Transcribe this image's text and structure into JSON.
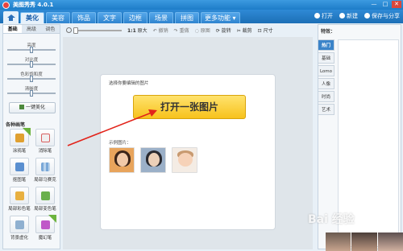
{
  "app": {
    "title": "美图秀秀 4.0.1"
  },
  "window": {
    "minimize": "—",
    "maximize": "□",
    "close": "✕"
  },
  "nav": {
    "tabs": [
      "美化",
      "美容",
      "饰品",
      "文字",
      "边框",
      "场景",
      "拼图"
    ],
    "more": "更多功能",
    "active_index": 0,
    "right": {
      "open": "打开",
      "new": "新建",
      "save": "保存与分享"
    }
  },
  "toolbar": {
    "zoom_actual": "1:1",
    "zoom_fit": "原大",
    "undo": "撤销",
    "redo": "重做",
    "original": "原图",
    "rotate": "旋转",
    "crop": "裁剪",
    "size": "尺寸"
  },
  "left": {
    "tabs": [
      "基础",
      "高级",
      "调色"
    ],
    "sliders": [
      {
        "label": "亮度",
        "value": 0.5
      },
      {
        "label": "对比度",
        "value": 0.5
      },
      {
        "label": "色彩饱和度",
        "value": 0.5
      },
      {
        "label": "清晰度",
        "value": 0.5
      }
    ],
    "auto_button": "一键美化",
    "pens_title": "各种画笔",
    "pens": [
      {
        "label": "涂鸦笔",
        "color": "#e0a030",
        "is_new": true
      },
      {
        "label": "消除笔",
        "color": "#d86060",
        "is_new": false
      },
      {
        "label": "抠图笔",
        "color": "#5a8fd0",
        "is_new": false
      },
      {
        "label": "局部马赛克",
        "color": "#7aa8d8",
        "is_new": false
      },
      {
        "label": "局部彩色笔",
        "color": "#e8b040",
        "is_new": false
      },
      {
        "label": "局部变色笔",
        "color": "#6ab04c",
        "is_new": false
      },
      {
        "label": "背景虚化",
        "color": "#8fb0d0",
        "is_new": false
      },
      {
        "label": "魔幻笔",
        "color": "#c058c8",
        "is_new": true
      }
    ]
  },
  "canvas": {
    "prompt": "选择你要编辑的图片",
    "open_button": "打开一张图片",
    "examples_label": "示例图片："
  },
  "right": {
    "title": "特效：",
    "tabs": [
      "热门",
      "基础",
      "Lomo",
      "人像",
      "时尚",
      "艺术"
    ],
    "active_index": 0
  },
  "watermark": "Bai 经验"
}
